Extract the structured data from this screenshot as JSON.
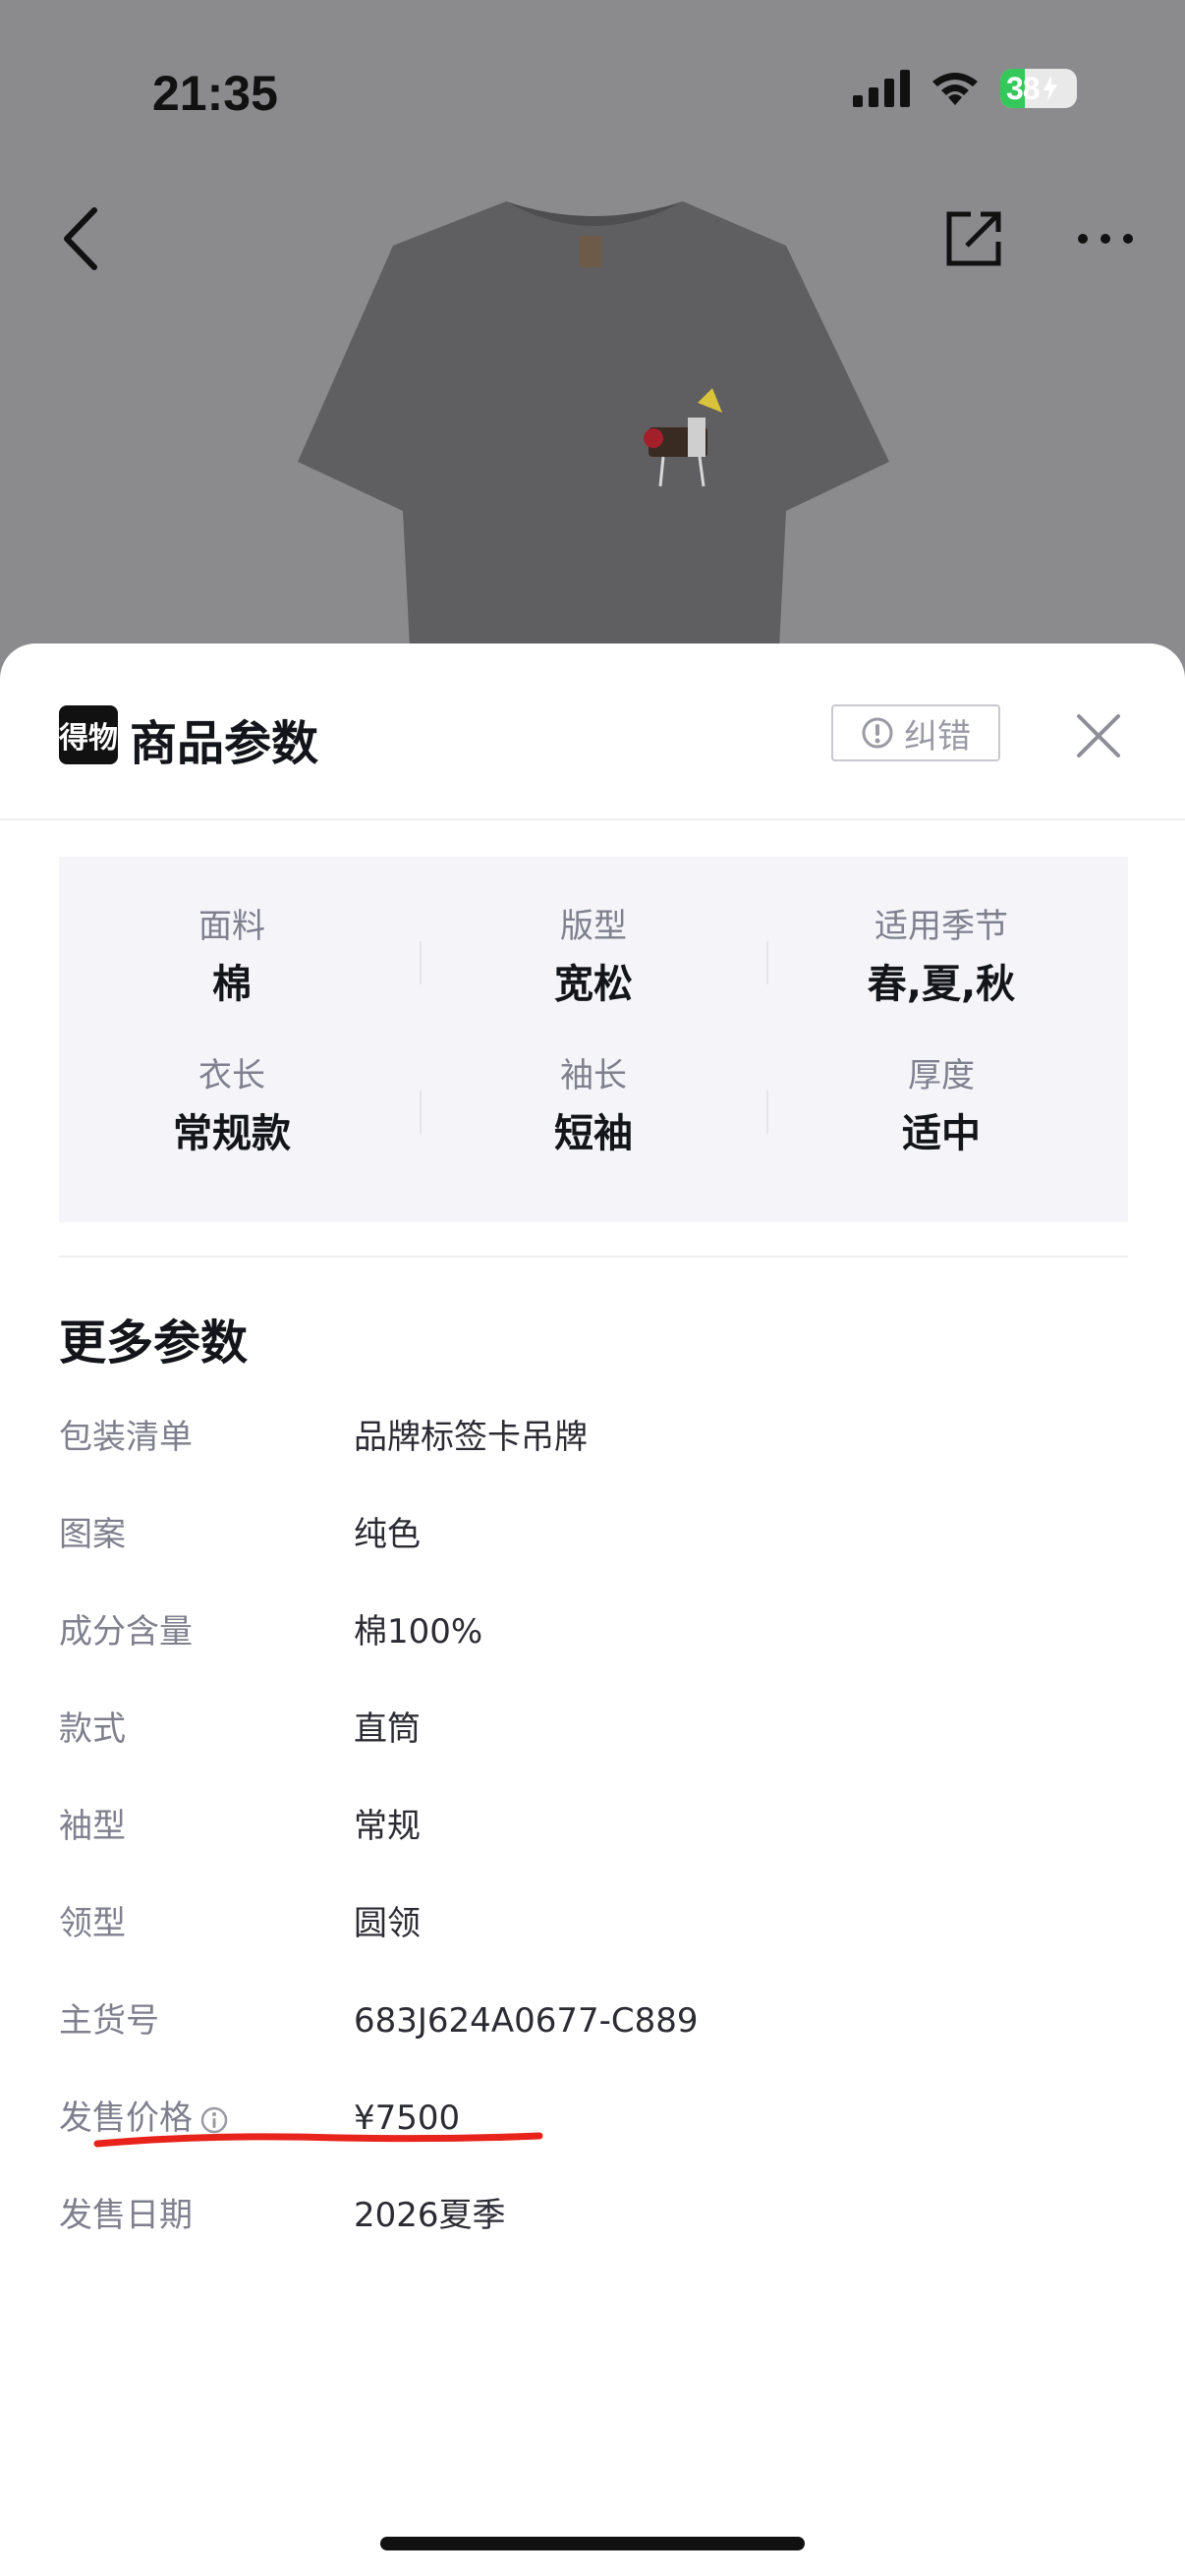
{
  "status_bar": {
    "time": "21:35",
    "battery": "38"
  },
  "nav": {
    "back_icon": "chevron-left-icon",
    "share_icon": "share-icon",
    "more_icon": "more-icon"
  },
  "sheet": {
    "logo_text": "得物",
    "title": "商品参数",
    "report_label": "纠错",
    "close_icon": "close-icon"
  },
  "summary": [
    {
      "label": "面料",
      "value": "棉"
    },
    {
      "label": "版型",
      "value": "宽松"
    },
    {
      "label": "适用季节",
      "value": "春,夏,秋"
    },
    {
      "label": "衣长",
      "value": "常规款"
    },
    {
      "label": "袖长",
      "value": "短袖"
    },
    {
      "label": "厚度",
      "value": "适中"
    }
  ],
  "more": {
    "title": "更多参数",
    "rows": [
      {
        "key": "包装清单",
        "value": "品牌标签卡吊牌"
      },
      {
        "key": "图案",
        "value": "纯色"
      },
      {
        "key": "成分含量",
        "value": "棉100%"
      },
      {
        "key": "款式",
        "value": "直筒"
      },
      {
        "key": "袖型",
        "value": "常规"
      },
      {
        "key": "领型",
        "value": "圆领"
      },
      {
        "key": "主货号",
        "value": "683J624A0677-C889"
      },
      {
        "key": "发售价格",
        "value": "¥7500"
      },
      {
        "key": "发售日期",
        "value": "2026夏季"
      }
    ]
  },
  "colors": {
    "accent_underline": "#e8231b",
    "battery_green": "#34c759"
  }
}
